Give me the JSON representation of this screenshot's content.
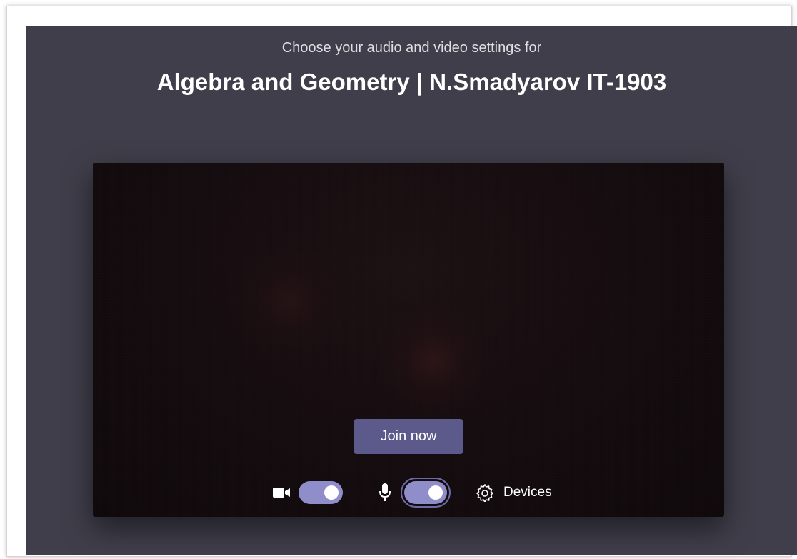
{
  "header": {
    "subtitle": "Choose your audio and video settings for",
    "meeting_title": "Algebra and Geometry | N.Smadyarov IT-1903"
  },
  "preview": {
    "join_label": "Join now"
  },
  "controls": {
    "camera": {
      "icon": "camera-icon",
      "on": true
    },
    "microphone": {
      "icon": "microphone-icon",
      "on": true
    },
    "devices": {
      "icon": "gear-icon",
      "label": "Devices"
    }
  },
  "colors": {
    "background": "#3f3e4a",
    "accent": "#5b5a8a",
    "toggle_on": "#8f8ecb"
  }
}
